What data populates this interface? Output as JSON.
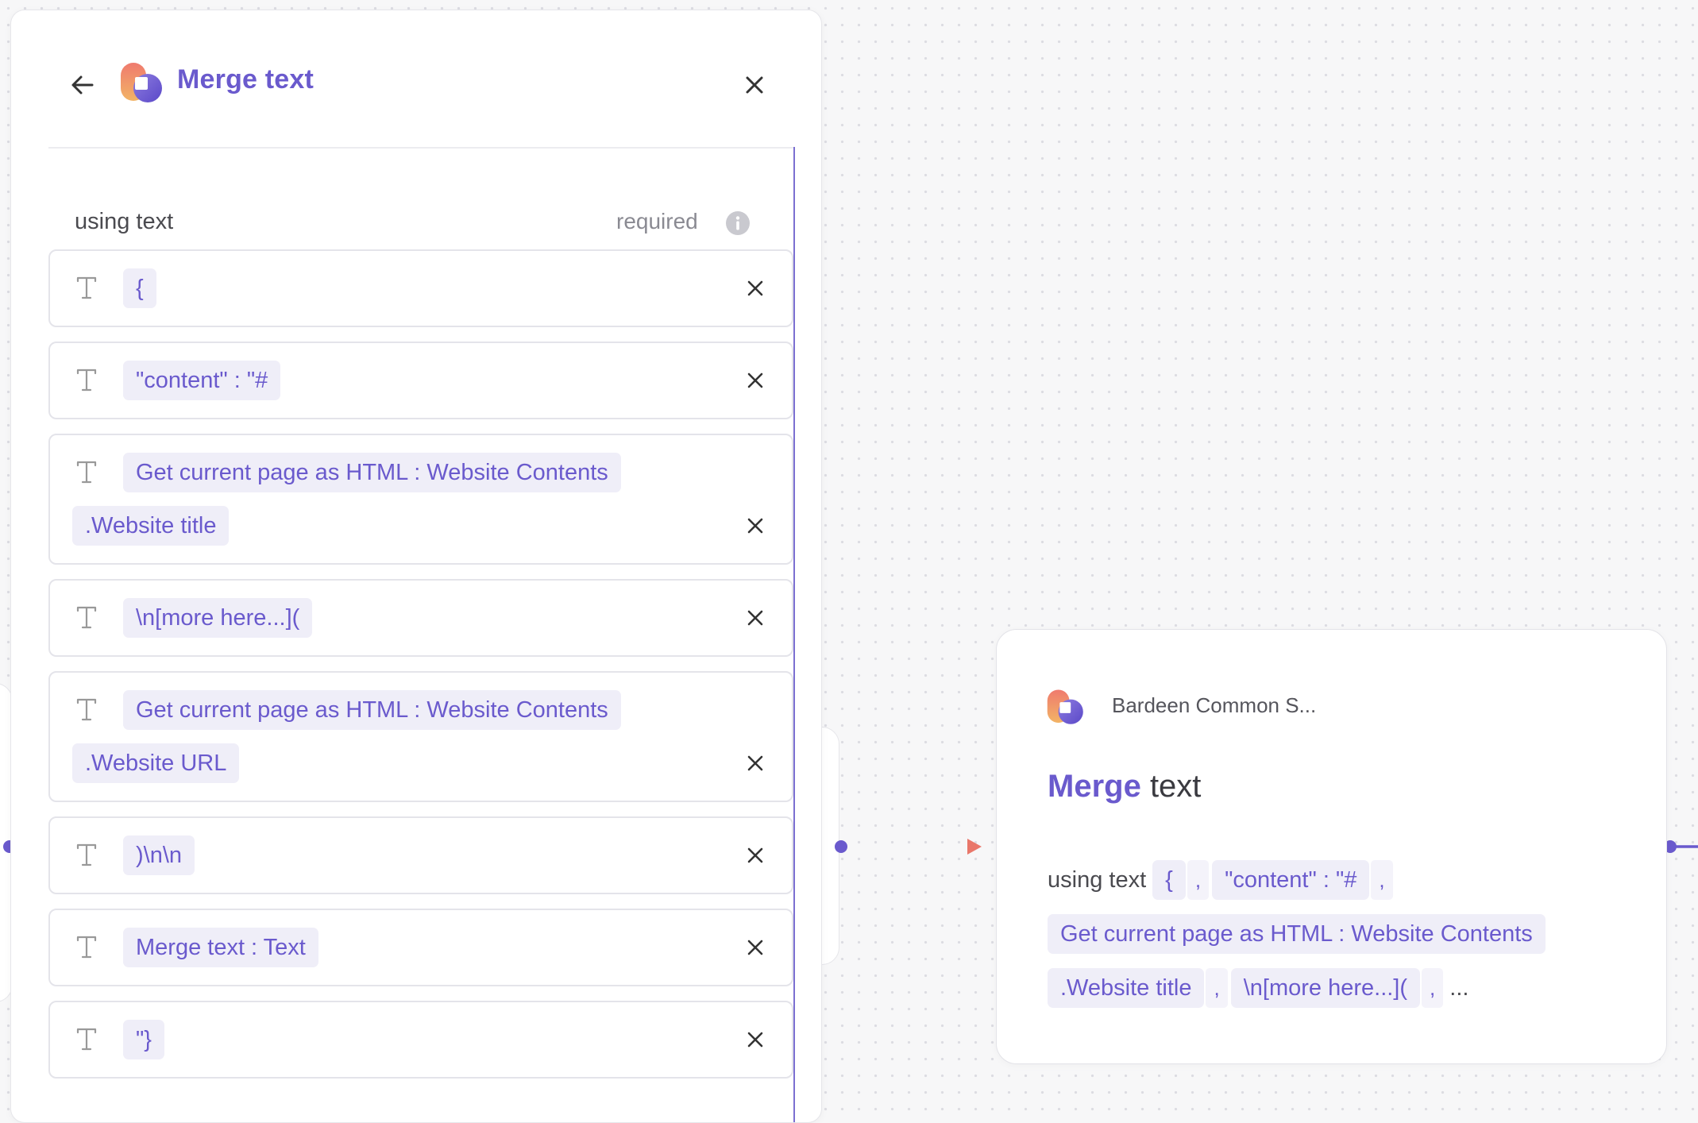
{
  "panel": {
    "title": "Merge text",
    "field_label": "using text",
    "required_label": "required",
    "rows": [
      {
        "chips": [
          "{"
        ]
      },
      {
        "chips": [
          "\"content\" : \"#"
        ]
      },
      {
        "chips": [
          "Get current page as HTML : Website Contents",
          ".Website title"
        ]
      },
      {
        "chips": [
          "\\n[more here...]("
        ]
      },
      {
        "chips": [
          "Get current page as HTML : Website Contents",
          ".Website URL"
        ]
      },
      {
        "chips": [
          ")\\n\\n"
        ]
      },
      {
        "chips": [
          "Merge text : Text"
        ]
      },
      {
        "chips": [
          "\"}"
        ]
      }
    ]
  },
  "node": {
    "app_name": "Bardeen Common S...",
    "title_accent": "Merge",
    "title_rest": "text",
    "summary_label": "using text",
    "summary_separator": ",",
    "summary_chips": [
      "{",
      "\"content\" : \"#",
      "Get current page as HTML : Website Contents",
      ".Website title",
      "\\n[more here...]("
    ],
    "summary_ellipsis": "..."
  },
  "colors": {
    "accent": "#6a5acd",
    "chip_bg": "#efeef8",
    "connector_end": "#e9776a"
  },
  "icons": [
    "back-arrow-icon",
    "close-icon",
    "text-type-icon",
    "info-icon",
    "bardeen-logo-icon",
    "arrow-right-icon"
  ]
}
